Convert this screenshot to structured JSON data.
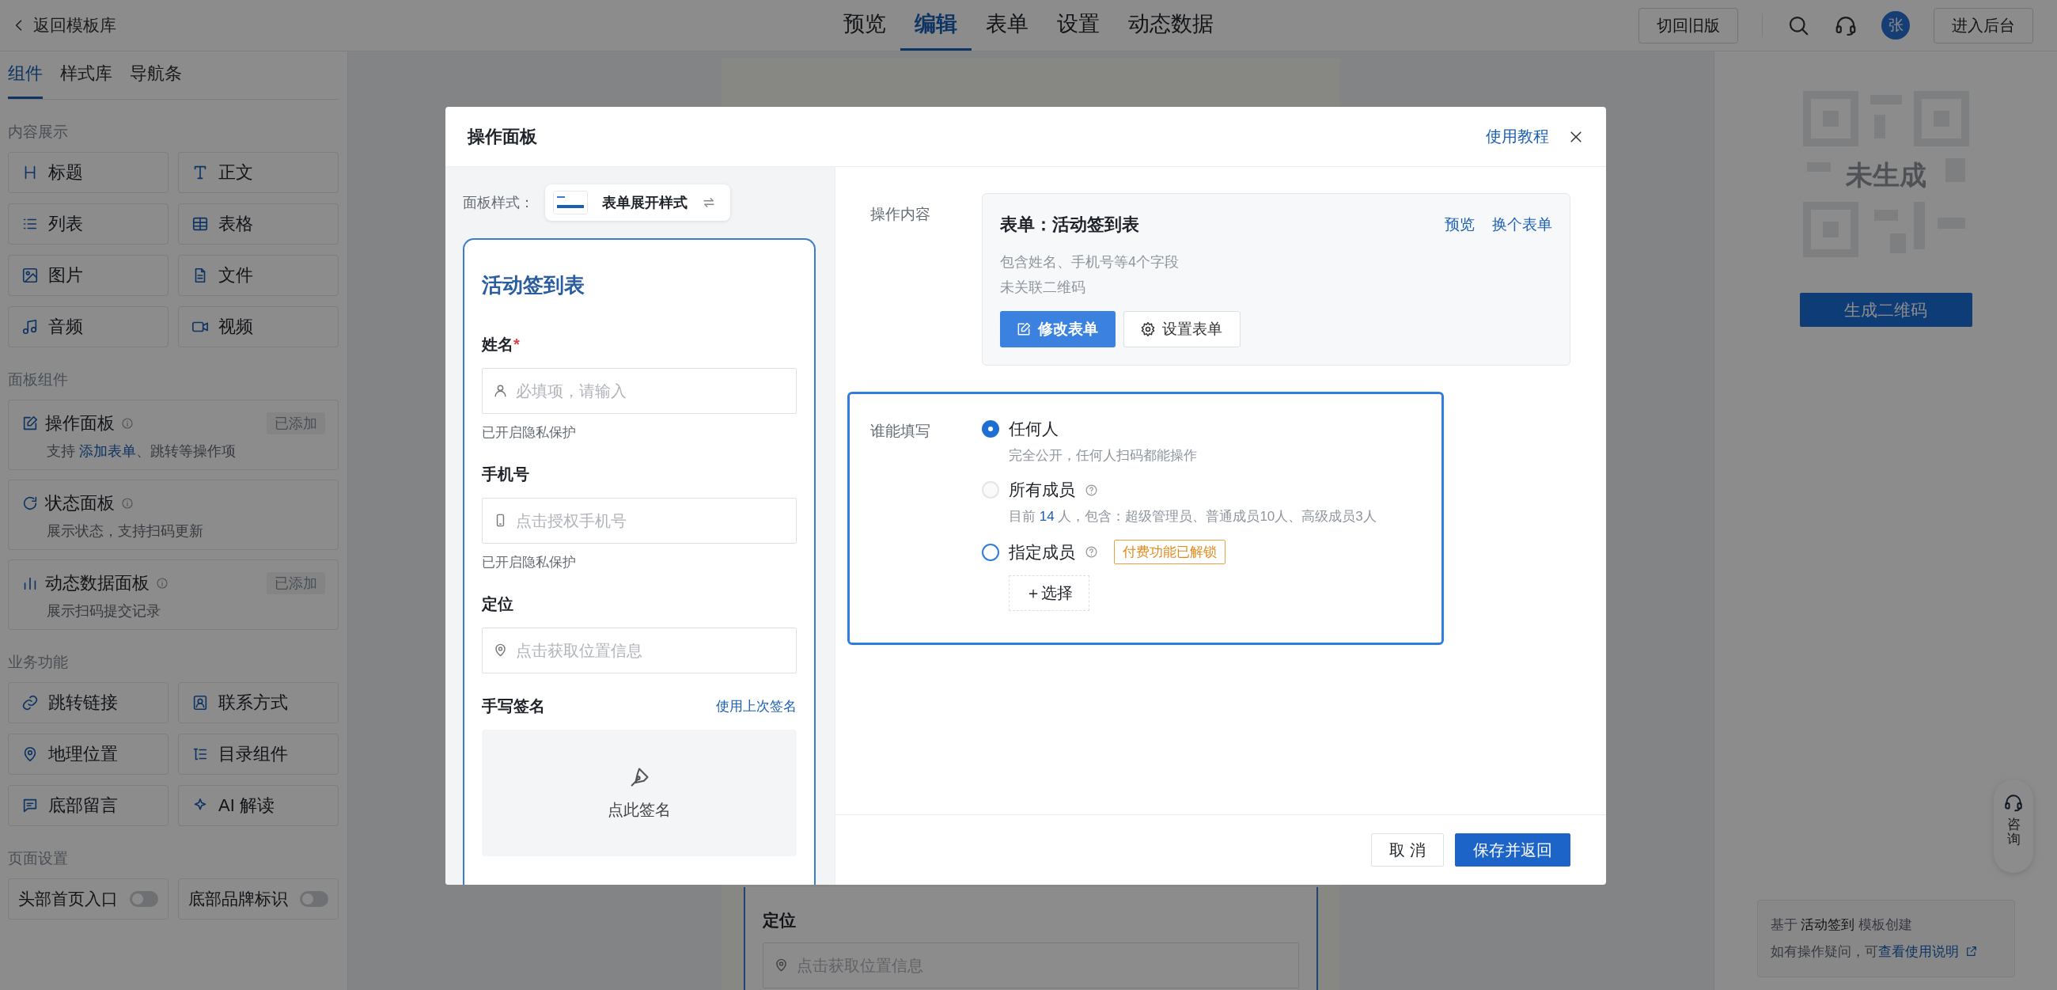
{
  "topbar": {
    "back": "返回模板库",
    "tabs": [
      {
        "label": "预览",
        "selected": false
      },
      {
        "label": "编辑",
        "selected": true
      },
      {
        "label": "表单",
        "selected": false
      },
      {
        "label": "设置",
        "selected": false
      },
      {
        "label": "动态数据",
        "selected": false
      }
    ],
    "old_version": "切回旧版",
    "avatar": "张",
    "admin": "进入后台"
  },
  "sidebar": {
    "tabs": [
      {
        "label": "组件",
        "selected": true
      },
      {
        "label": "样式库",
        "selected": false
      },
      {
        "label": "导航条",
        "selected": false
      }
    ],
    "sections": [
      {
        "title": "内容展示",
        "kind": "grid",
        "items": [
          "标题",
          "正文",
          "列表",
          "表格",
          "图片",
          "文件",
          "音频",
          "视频"
        ]
      },
      {
        "title": "面板组件",
        "kind": "cards",
        "items": [
          {
            "name": "操作面板",
            "badge": "已添加",
            "desc": "支持 ",
            "link": "添加表单",
            "desc_after": "、跳转等操作项"
          },
          {
            "name": "状态面板",
            "desc": "展示状态，支持扫码更新"
          },
          {
            "name": "动态数据面板",
            "badge": "已添加",
            "desc": "展示扫码提交记录"
          }
        ]
      },
      {
        "title": "业务功能",
        "kind": "grid",
        "items": [
          "跳转链接",
          "联系方式",
          "地理位置",
          "目录组件",
          "底部留言",
          "AI 解读"
        ]
      },
      {
        "title": "页面设置",
        "kind": "toggles",
        "items": [
          {
            "label": "头部首页入口",
            "on": false
          },
          {
            "label": "底部品牌标识",
            "on": false
          }
        ]
      }
    ]
  },
  "canvas": {
    "field_label": "定位",
    "field_placeholder": "点击获取位置信息"
  },
  "right_panel": {
    "qr_status": "未生成",
    "generate": "生成二维码",
    "consult": "咨询",
    "info_line": "基于 **活动签到** 模板创建",
    "help": "如有操作疑问，可",
    "help_link": "查看使用说明"
  },
  "modal": {
    "title": "操作面板",
    "tutorial": "使用教程",
    "style_label": "面板样式：",
    "style_value": "表单展开样式",
    "form_preview": {
      "title": "活动签到表",
      "fields": [
        {
          "kind": "input",
          "label": "姓名",
          "required_mark": "*",
          "placeholder": "必填项，请输入",
          "note": "已开启隐私保护"
        },
        {
          "kind": "input",
          "label": "手机号",
          "placeholder": "点击授权手机号",
          "note": "已开启隐私保护"
        },
        {
          "kind": "input",
          "label": "定位",
          "placeholder": "点击获取位置信息"
        },
        {
          "kind": "signature",
          "label": "手写签名",
          "link": "使用上次签名",
          "placeholder": "点此签名"
        }
      ]
    },
    "content": {
      "label": "操作内容",
      "title": "表单：活动签到表",
      "links": [
        "预览",
        "换个表单"
      ],
      "lines": [
        "包含姓名、手机号等4个字段",
        "未关联二维码"
      ],
      "buttons": [
        {
          "label": "修改表单",
          "kind": "primary"
        },
        {
          "label": "设置表单",
          "kind": "default"
        }
      ]
    },
    "who": {
      "label": "谁能填写",
      "options": [
        {
          "label": "任何人",
          "selected": true,
          "disabled": false,
          "help": false,
          "desc": "完全公开，任何人扫码都能操作"
        },
        {
          "label": "所有成员",
          "selected": false,
          "disabled": true,
          "help": true,
          "desc": "目前 ",
          "count": "14",
          "desc_after": " 人，包含：超级管理员、普通成员10人、高级成员3人"
        },
        {
          "label": "指定成员",
          "selected": false,
          "disabled": false,
          "help": true,
          "tag": "付费功能已解锁",
          "action": "＋选择"
        }
      ]
    },
    "footer": {
      "cancel": "取 消",
      "save": "保存并返回"
    }
  }
}
